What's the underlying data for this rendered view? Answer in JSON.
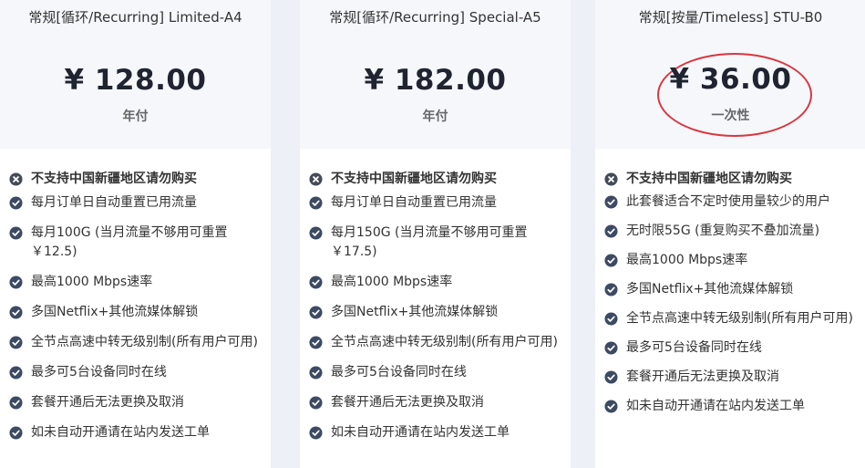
{
  "plans": [
    {
      "title": "常规[循环/Recurring] Limited-A4",
      "price": "¥ 128.00",
      "period": "年付",
      "features": [
        {
          "icon": "x-circle-icon",
          "text": "不支持中国新疆地区请勿购买"
        },
        {
          "icon": "check-circle-icon",
          "text": "每月订单日自动重置已用流量"
        },
        {
          "icon": "check-circle-icon",
          "text": "每月100G (当月流量不够用可重置 ￥12.5)"
        },
        {
          "icon": "check-circle-icon",
          "text": "最高1000 Mbps速率"
        },
        {
          "icon": "check-circle-icon",
          "text": "多国Netflix+其他流媒体解锁"
        },
        {
          "icon": "check-circle-icon",
          "text": "全节点高速中转无级别制(所有用户可用)"
        },
        {
          "icon": "check-circle-icon",
          "text": "最多可5台设备同时在线"
        },
        {
          "icon": "check-circle-icon",
          "text": "套餐开通后无法更换及取消"
        },
        {
          "icon": "check-circle-icon",
          "text": "如未自动开通请在站内发送工单"
        }
      ]
    },
    {
      "title": "常规[循环/Recurring] Special-A5",
      "price": "¥ 182.00",
      "period": "年付",
      "features": [
        {
          "icon": "x-circle-icon",
          "text": "不支持中国新疆地区请勿购买"
        },
        {
          "icon": "check-circle-icon",
          "text": "每月订单日自动重置已用流量"
        },
        {
          "icon": "check-circle-icon",
          "text": "每月150G (当月流量不够用可重置 ￥17.5)"
        },
        {
          "icon": "check-circle-icon",
          "text": "最高1000 Mbps速率"
        },
        {
          "icon": "check-circle-icon",
          "text": "多国Netflix+其他流媒体解锁"
        },
        {
          "icon": "check-circle-icon",
          "text": "全节点高速中转无级别制(所有用户可用)"
        },
        {
          "icon": "check-circle-icon",
          "text": "最多可5台设备同时在线"
        },
        {
          "icon": "check-circle-icon",
          "text": "套餐开通后无法更换及取消"
        },
        {
          "icon": "check-circle-icon",
          "text": "如未自动开通请在站内发送工单"
        }
      ]
    },
    {
      "title": "常规[按量/Timeless] STU-B0",
      "price": "¥ 36.00",
      "period": "一次性",
      "features": [
        {
          "icon": "x-circle-icon",
          "text": "不支持中国新疆地区请勿购买"
        },
        {
          "icon": "check-circle-icon",
          "text": "此套餐适合不定时使用量较少的用户"
        },
        {
          "icon": "check-circle-icon",
          "text": "无时限55G (重复购买不叠加流量)"
        },
        {
          "icon": "check-circle-icon",
          "text": "最高1000 Mbps速率"
        },
        {
          "icon": "check-circle-icon",
          "text": "多国Netflix+其他流媒体解锁"
        },
        {
          "icon": "check-circle-icon",
          "text": "全节点高速中转无级别制(所有用户可用)"
        },
        {
          "icon": "check-circle-icon",
          "text": "最多可5台设备同时在线"
        },
        {
          "icon": "check-circle-icon",
          "text": "套餐开通后无法更换及取消"
        },
        {
          "icon": "check-circle-icon",
          "text": "如未自动开通请在站内发送工单"
        }
      ]
    }
  ],
  "colors": {
    "check_icon": "#3d4a63",
    "x_icon": "#444b57",
    "highlight_ring": "#d9363e",
    "header_bg": "#f6f7fb",
    "page_bg": "#eef0f7"
  }
}
